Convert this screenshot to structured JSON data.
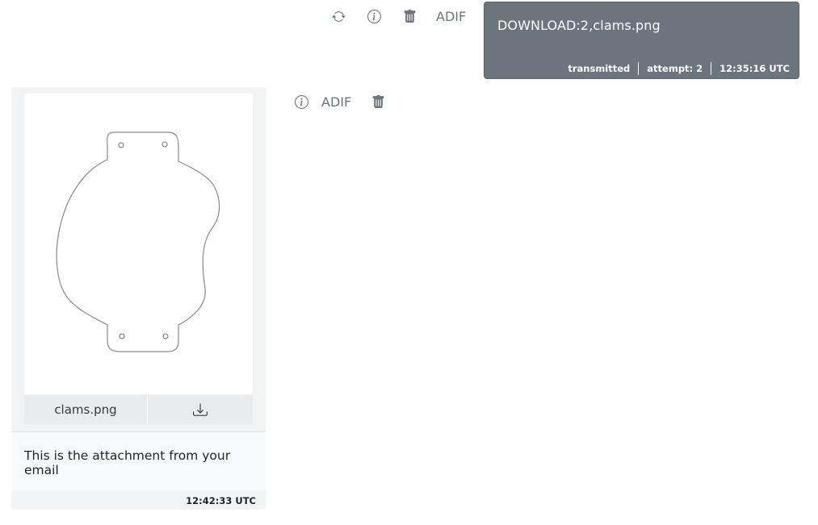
{
  "outgoing": {
    "actions": {
      "retry_icon": "refresh-icon",
      "info_icon": "info-icon",
      "delete_icon": "trash-icon",
      "adif_label": "ADIF"
    },
    "text": "DOWNLOAD:2,clams.png",
    "status": "transmitted",
    "attempt": "attempt: 2",
    "time": "12:35:16 UTC",
    "bubble_color": "#6c757d"
  },
  "incoming": {
    "attachment": {
      "filename": "clams.png",
      "download_icon": "download-icon"
    },
    "text": "This is the attachment from your email",
    "time": "12:42:33 UTC",
    "actions": {
      "info_icon": "info-icon",
      "adif_label": "ADIF",
      "delete_icon": "trash-icon"
    },
    "card_color": "#f1f3f4"
  }
}
